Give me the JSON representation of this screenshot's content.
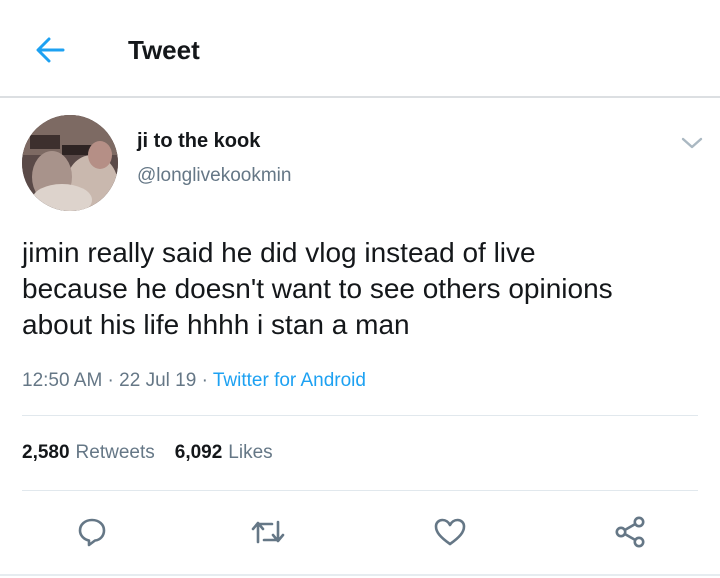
{
  "header": {
    "title": "Tweet",
    "back_icon": "arrow-left-icon"
  },
  "author": {
    "display_name": "ji to the kook",
    "handle": "@longlivekookmin"
  },
  "tweet": {
    "text": "jimin really said he did vlog instead of live\nbecause he doesn't want to see others opinions\nabout his life hhhh i stan a man",
    "time": "12:50 AM",
    "separator": " · ",
    "date": "22 Jul 19",
    "source": "Twitter for Android"
  },
  "stats": {
    "retweets_count": "2,580",
    "retweets_label": "Retweets",
    "likes_count": "6,092",
    "likes_label": "Likes"
  },
  "actions": [
    "reply-icon",
    "retweet-icon",
    "like-icon",
    "share-icon"
  ],
  "colors": {
    "accent": "#1da1f2",
    "text": "#14171a",
    "secondary": "#657786",
    "divider": "#e1e8ed"
  }
}
